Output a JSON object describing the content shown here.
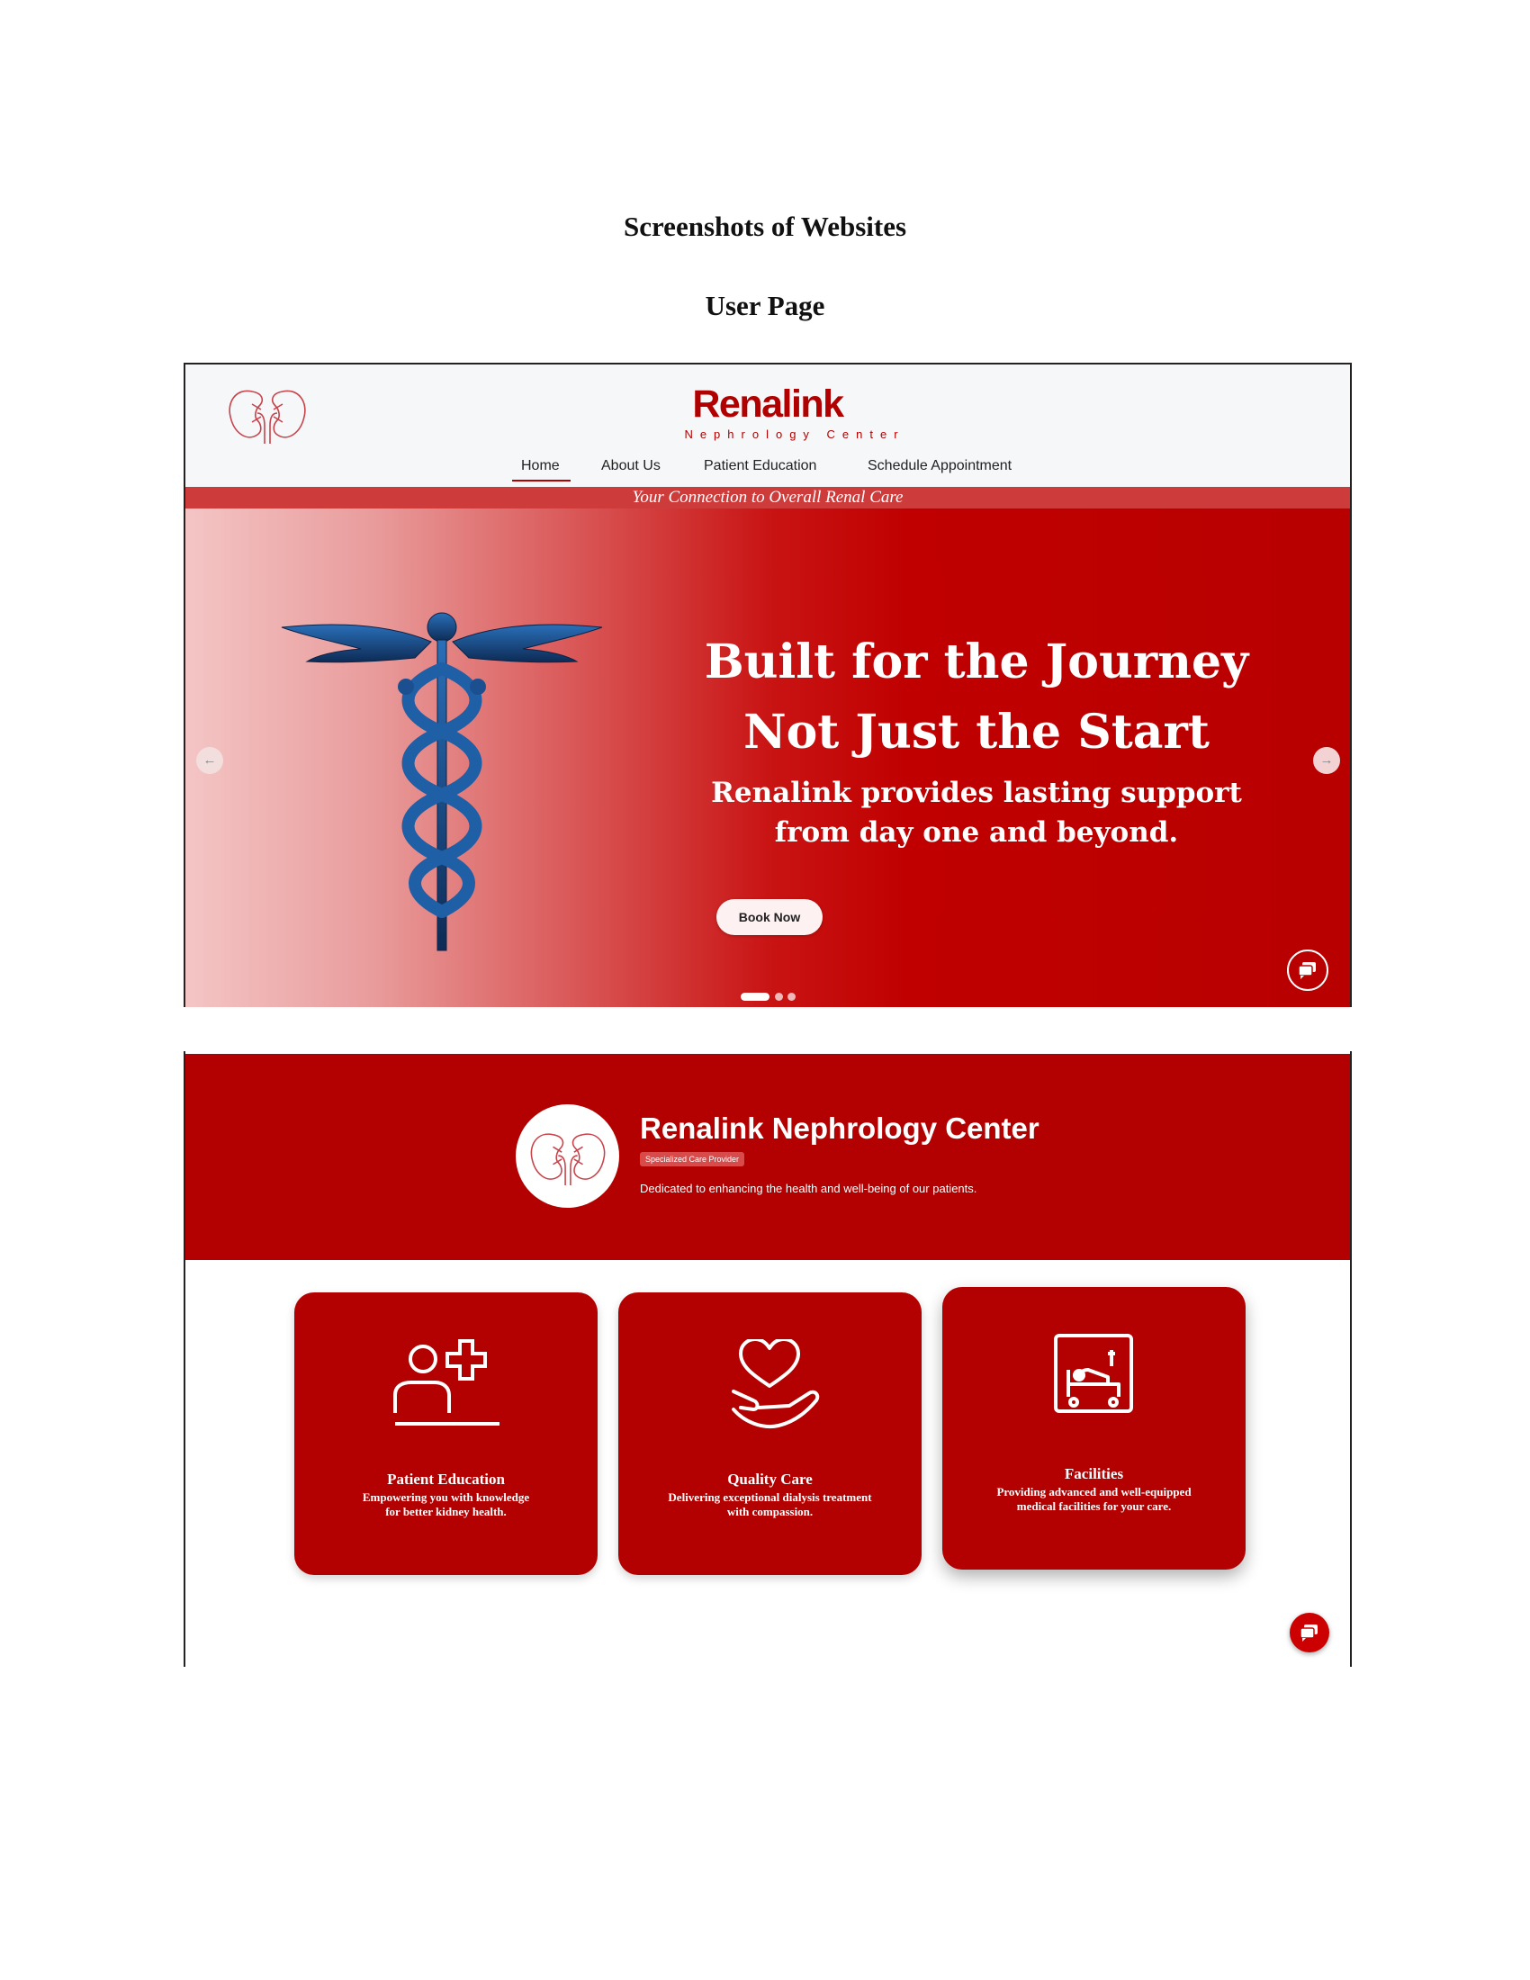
{
  "document": {
    "title": "Screenshots of Websites",
    "subtitle": "User Page"
  },
  "screenshot_home": {
    "logo_icon": "kidneys-icon",
    "brand_name": "Renalink",
    "brand_subtitle": "Nephrology Center",
    "nav": [
      {
        "label": "Home",
        "active": true
      },
      {
        "label": "About Us",
        "active": false
      },
      {
        "label": "Patient Education",
        "active": false
      },
      {
        "label": "Schedule Appointment",
        "active": false
      }
    ],
    "tagline": "Your Connection to Overall Renal Care",
    "hero": {
      "image_icon": "caduceus-icon",
      "headline_1": "Built for the Journey",
      "headline_2": "Not Just the Start",
      "subhead_1": "Renalink provides lasting support",
      "subhead_2": "from day one and beyond.",
      "cta_label": "Book Now",
      "prev_arrow": "←",
      "next_arrow": "→",
      "slide_count": 3,
      "active_slide": 1
    },
    "chat_icon": "chat-bubbles-icon",
    "colors": {
      "brand_red": "#b00000",
      "tagbar": "#cd3b3b"
    }
  },
  "screenshot_features": {
    "banner": {
      "title": "Renalink Nephrology Center",
      "badge": "Specialized Care Provider",
      "description": "Dedicated to enhancing the health and well-being of our patients."
    },
    "cards": [
      {
        "icon": "patient-education-icon",
        "title": "Patient Education",
        "desc_1": "Empowering you with knowledge",
        "desc_2": "for better kidney health."
      },
      {
        "icon": "heart-hand-icon",
        "title": "Quality Care",
        "desc_1": "Delivering exceptional dialysis treatment",
        "desc_2": "with compassion."
      },
      {
        "icon": "hospital-bed-icon",
        "title": "Facilities",
        "desc_1": "Providing advanced and well-equipped",
        "desc_2": "medical facilities for your care."
      }
    ],
    "chat_icon": "chat-bubbles-icon",
    "colors": {
      "banner_red": "#b30000",
      "card_red": "#b30000"
    }
  }
}
